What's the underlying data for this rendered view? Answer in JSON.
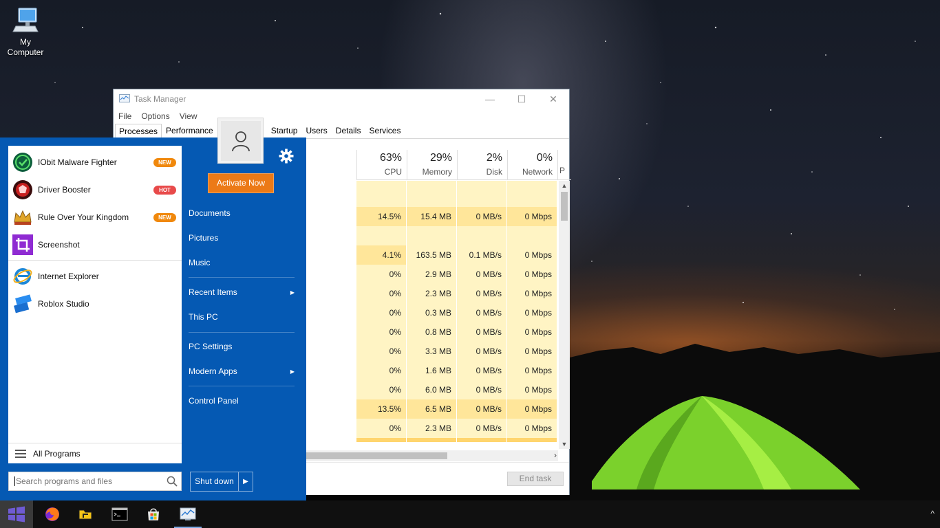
{
  "desktop": {
    "icon_label": "My\nComputer",
    "icon_name": "my-computer-icon"
  },
  "task_manager": {
    "title": "Task Manager",
    "menu": [
      "File",
      "Options",
      "View"
    ],
    "tabs": [
      "Processes",
      "Performance",
      "Startup",
      "Users",
      "Details",
      "Services"
    ],
    "active_tab": "Processes",
    "columns": [
      {
        "pct": "63%",
        "name": "CPU"
      },
      {
        "pct": "29%",
        "name": "Memory"
      },
      {
        "pct": "2%",
        "name": "Disk"
      },
      {
        "pct": "0%",
        "name": "Network"
      }
    ],
    "extra_column_fragment": "P",
    "rows": [
      {
        "cpu": "14.5%",
        "memory": "15.4 MB",
        "disk": "0 MB/s",
        "network": "0 Mbps"
      },
      {
        "cpu": "",
        "memory": "",
        "disk": "",
        "network": ""
      },
      {
        "cpu": "4.1%",
        "memory": "163.5 MB",
        "disk": "0.1 MB/s",
        "network": "0 Mbps"
      },
      {
        "cpu": "0%",
        "memory": "2.9 MB",
        "disk": "0 MB/s",
        "network": "0 Mbps"
      },
      {
        "cpu": "0%",
        "memory": "2.3 MB",
        "disk": "0 MB/s",
        "network": "0 Mbps"
      },
      {
        "cpu": "0%",
        "memory": "0.3 MB",
        "disk": "0 MB/s",
        "network": "0 Mbps"
      },
      {
        "cpu": "0%",
        "memory": "0.8 MB",
        "disk": "0 MB/s",
        "network": "0 Mbps"
      },
      {
        "cpu": "0%",
        "memory": "3.3 MB",
        "disk": "0 MB/s",
        "network": "0 Mbps"
      },
      {
        "cpu": "0%",
        "memory": "1.6 MB",
        "disk": "0 MB/s",
        "network": "0 Mbps"
      },
      {
        "cpu": "0%",
        "memory": "6.0 MB",
        "disk": "0 MB/s",
        "network": "0 Mbps"
      },
      {
        "cpu": "13.5%",
        "memory": "6.5 MB",
        "disk": "0 MB/s",
        "network": "0 Mbps"
      },
      {
        "cpu": "0%",
        "memory": "2.3 MB",
        "disk": "0 MB/s",
        "network": "0 Mbps"
      }
    ],
    "end_task_label": "End task"
  },
  "start_menu": {
    "pinned": [
      {
        "label": "IObit Malware Fighter",
        "icon": "iobit-malware-fighter-icon",
        "badge": "NEW",
        "badge_color": "#f0880c"
      },
      {
        "label": "Driver Booster",
        "icon": "driver-booster-icon",
        "badge": "HOT",
        "badge_color": "#e84a4a"
      },
      {
        "label": "Rule Over Your Kingdom",
        "icon": "crown-icon",
        "badge": "NEW",
        "badge_color": "#f0880c"
      },
      {
        "label": "Screenshot",
        "icon": "screenshot-crop-icon",
        "badge": "",
        "badge_color": ""
      }
    ],
    "recent": [
      {
        "label": "Internet Explorer",
        "icon": "internet-explorer-icon"
      },
      {
        "label": "Roblox Studio",
        "icon": "roblox-studio-icon"
      }
    ],
    "all_programs_label": "All Programs",
    "search_placeholder": "Search programs and files",
    "activate_label": "Activate Now",
    "right_items": [
      {
        "label": "Documents",
        "has_submenu": false
      },
      {
        "label": "Pictures",
        "has_submenu": false
      },
      {
        "label": "Music",
        "has_submenu": false
      },
      {
        "label": "Recent Items",
        "has_submenu": true
      },
      {
        "label": "This PC",
        "has_submenu": false
      },
      {
        "label": "PC Settings",
        "has_submenu": false
      },
      {
        "label": "Modern Apps",
        "has_submenu": true
      },
      {
        "label": "Control Panel",
        "has_submenu": false
      }
    ],
    "shutdown_label": "Shut down",
    "accent_color": "#0559b3",
    "activate_color": "#ec7a17"
  },
  "taskbar": {
    "items": [
      "start-button",
      "firefox-icon",
      "folder-app-icon",
      "command-prompt-icon",
      "microsoft-store-icon",
      "task-manager-icon"
    ],
    "active_item": "task-manager-icon",
    "tray_chevron": "^"
  }
}
